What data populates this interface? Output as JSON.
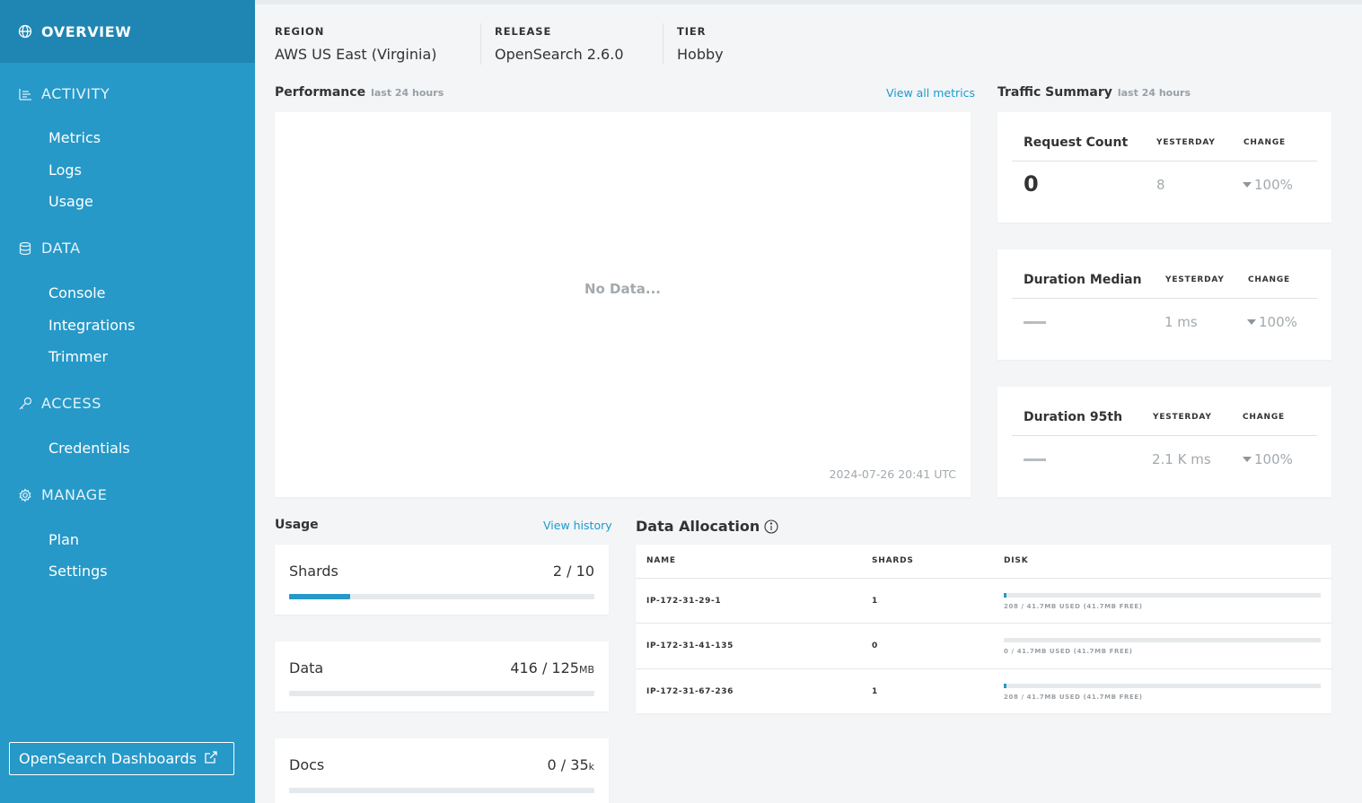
{
  "sidebar": {
    "active": {
      "label": "OVERVIEW"
    },
    "sections": [
      {
        "title": "ACTIVITY",
        "items": [
          "Metrics",
          "Logs",
          "Usage"
        ]
      },
      {
        "title": "DATA",
        "items": [
          "Console",
          "Integrations",
          "Trimmer"
        ]
      },
      {
        "title": "ACCESS",
        "items": [
          "Credentials"
        ]
      },
      {
        "title": "MANAGE",
        "items": [
          "Plan",
          "Settings"
        ]
      }
    ],
    "dashboards_button": "OpenSearch Dashboards",
    "colors": {
      "bg": "#2699c8",
      "active_bg": "#1f86b3"
    }
  },
  "info": {
    "region": {
      "label": "REGION",
      "value": "AWS US East (Virginia)"
    },
    "release": {
      "label": "RELEASE",
      "value": "OpenSearch 2.6.0"
    },
    "tier": {
      "label": "TIER",
      "value": "Hobby"
    }
  },
  "performance": {
    "title": "Performance",
    "subtitle": "last 24 hours",
    "link": "View all metrics",
    "empty_text": "No Data...",
    "timestamp": "2024-07-26 20:41 UTC"
  },
  "traffic": {
    "title": "Traffic Summary",
    "subtitle": "last 24 hours",
    "cards": [
      {
        "title": "Request Count",
        "col_yesterday": "YESTERDAY",
        "col_change": "CHANGE",
        "today": "0",
        "yesterday": "8",
        "change": "100%"
      },
      {
        "title": "Duration Median",
        "col_yesterday": "YESTERDAY",
        "col_change": "CHANGE",
        "today": "",
        "yesterday": "1 ms",
        "change": "100%"
      },
      {
        "title": "Duration 95th",
        "col_yesterday": "YESTERDAY",
        "col_change": "CHANGE",
        "today": "",
        "yesterday": "2.1 K ms",
        "change": "100%"
      }
    ]
  },
  "usage": {
    "title": "Usage",
    "link": "View history",
    "cards": [
      {
        "label": "Shards",
        "value": "2 / 10",
        "unit": "",
        "fill": 0.2
      },
      {
        "label": "Data",
        "value": "416 / 125",
        "unit": "MB",
        "fill": 0.0
      },
      {
        "label": "Docs",
        "value": "0 / 35",
        "unit": "k",
        "fill": 0.0
      }
    ]
  },
  "data_allocation": {
    "title": "Data Allocation",
    "headers": {
      "name": "NAME",
      "shards": "SHARDS",
      "disk": "DISK"
    },
    "rows": [
      {
        "name": "IP-172-31-29-1",
        "shards": "1",
        "disk": "208 / 41.7MB USED (41.7MB FREE)",
        "fill": 0.005
      },
      {
        "name": "IP-172-31-41-135",
        "shards": "0",
        "disk": "0 / 41.7MB USED (41.7MB FREE)",
        "fill": 0.0
      },
      {
        "name": "IP-172-31-67-236",
        "shards": "1",
        "disk": "208 / 41.7MB USED (41.7MB FREE)",
        "fill": 0.005
      }
    ]
  }
}
